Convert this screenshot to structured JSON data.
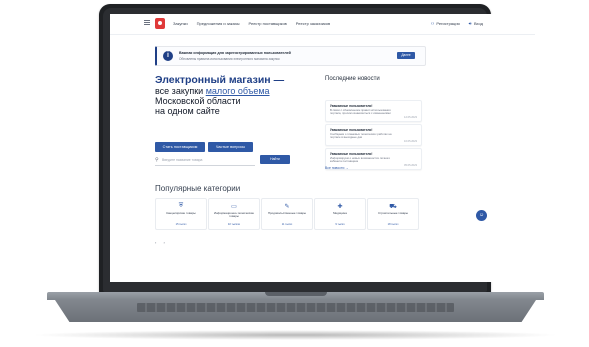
{
  "nav": {
    "items": [
      "Закупки",
      "Предложения и заказы",
      "Реестр поставщиков",
      "Реестр заказчиков"
    ],
    "login": "Регистрация",
    "sign_in": "Вход"
  },
  "notice": {
    "title": "Важная информация для зарегистрированных пользователей",
    "text": "Обновлены правила использования электронного магазина закупок",
    "button": "Далее"
  },
  "hero": {
    "line1": "Электронный магазин —",
    "line2_prefix": "все закупки ",
    "line2_highlight": "малого объема",
    "line3": "Московской области",
    "line4": "на одном сайте"
  },
  "actions": {
    "become_supplier": "Стать поставщиком",
    "faq": "Частые вопросы",
    "search_placeholder": "Введите название товара",
    "search_button": "Найти"
  },
  "news": {
    "title": "Последние новости",
    "items": [
      {
        "title": "Уважаемые пользователи!",
        "text": "В связи с обновлением правил использования портала, просим ознакомиться с изменениями",
        "date": "12.05.2023"
      },
      {
        "title": "Уважаемые пользователи!",
        "text": "Сообщаем о плановых технических работах на портале в выходные дни",
        "date": "10.05.2023"
      },
      {
        "title": "Уважаемые пользователи!",
        "text": "Информируем о новых возможностях личного кабинета поставщика",
        "date": "05.05.2023"
      }
    ],
    "all_link": "Все новости →"
  },
  "categories": {
    "title": "Популярные категории",
    "items": [
      {
        "icon": "shield-icon",
        "glyph": "⛨",
        "label": "Канцелярские товары",
        "count": "15 тысяч"
      },
      {
        "icon": "monitor-icon",
        "glyph": "▭",
        "label": "Информационно-технические товары",
        "count": "32 тысячи"
      },
      {
        "icon": "pencil-icon",
        "glyph": "✎",
        "label": "Продовольственные товары",
        "count": "11 тысяч"
      },
      {
        "icon": "medicine-icon",
        "glyph": "✚",
        "label": "Медицина",
        "count": "9 тысяч"
      },
      {
        "icon": "truck-icon",
        "glyph": "⛟",
        "label": "Строительные товары",
        "count": "18 тысяч"
      }
    ]
  },
  "pager": {
    "prev": "‹",
    "next": "›"
  },
  "fab": {
    "glyph": "☺"
  }
}
